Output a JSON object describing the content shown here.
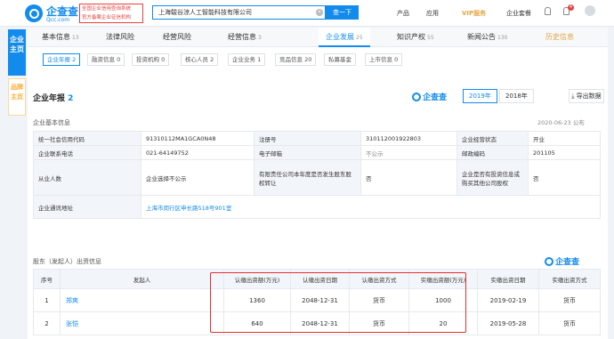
{
  "header": {
    "logo_text": "企查查",
    "logo_sub": "Qcc.com",
    "badge_line1": "全国企业信用查询系统",
    "badge_line2": "官方备案企业征信机构",
    "search_value": "上海駿谷涼人工智能科技有限公司",
    "search_button": "查一下",
    "nav": [
      "产品",
      "应用",
      "VIP服务",
      "企业套餐"
    ],
    "notification_count": "4"
  },
  "side_tabs": {
    "active": "企业主页",
    "inactive": "品牌主页"
  },
  "tabs": [
    {
      "label": "基本信息",
      "count": "13"
    },
    {
      "label": "法律风险",
      "count": ""
    },
    {
      "label": "经营风险",
      "count": ""
    },
    {
      "label": "经营信息",
      "count": "3"
    },
    {
      "label": "企业发展",
      "count": "25"
    },
    {
      "label": "知识产权",
      "count": "55"
    },
    {
      "label": "新闻公告",
      "count": "130"
    },
    {
      "label": "历史信息",
      "count": ""
    }
  ],
  "subtabs": [
    "企业年报 2",
    "融资信息 0",
    "投资机构 0",
    "核心人员 2",
    "企业业务 1",
    "竞品信息 20",
    "私募基金",
    "上市信息 0"
  ],
  "annual_report": {
    "title": "企业年报",
    "count": "2",
    "brand": "企查查",
    "years": [
      "2019年",
      "2018年"
    ],
    "export": "导出数据",
    "basic_info_title": "企业基本信息",
    "published": "2020-06-23 公布",
    "rows": [
      [
        "统一社会信用代码",
        "91310112MA1GCA0N48",
        "注册号",
        "310112001922803",
        "企业经营状态",
        "开业"
      ],
      [
        "企业联系电话",
        "021-64149752",
        "电子邮箱",
        "不公示",
        "邮政编码",
        "201105"
      ],
      [
        "从业人数",
        "企业选择不公示",
        "有限责任公司本年度是否发生股东股权转让",
        "否",
        "企业是否有投资信息或购买其他公司股权",
        "否"
      ]
    ],
    "address_label": "企业通讯地址",
    "address_value": "上海市闵行区申长路518号901室"
  },
  "investors": {
    "title": "股东（发起人）出资信息",
    "brand": "企查查",
    "headers": [
      "序号",
      "发起人",
      "认缴出资额(万元)",
      "认缴出资日期",
      "认缴出资方式",
      "实缴出资额(万元)",
      "实缴出资日期",
      "实缴出资方式"
    ],
    "rows": [
      [
        "1",
        "郑爽",
        "1360",
        "2048-12-31",
        "货币",
        "1000",
        "2019-02-19",
        "货币"
      ],
      [
        "2",
        "张恺",
        "640",
        "2048-12-31",
        "货币",
        "20",
        "2019-05-28",
        "货币"
      ]
    ]
  },
  "colors": {
    "accent": "#128bed",
    "highlight": "#e52e2e",
    "gold": "#e3a645"
  }
}
